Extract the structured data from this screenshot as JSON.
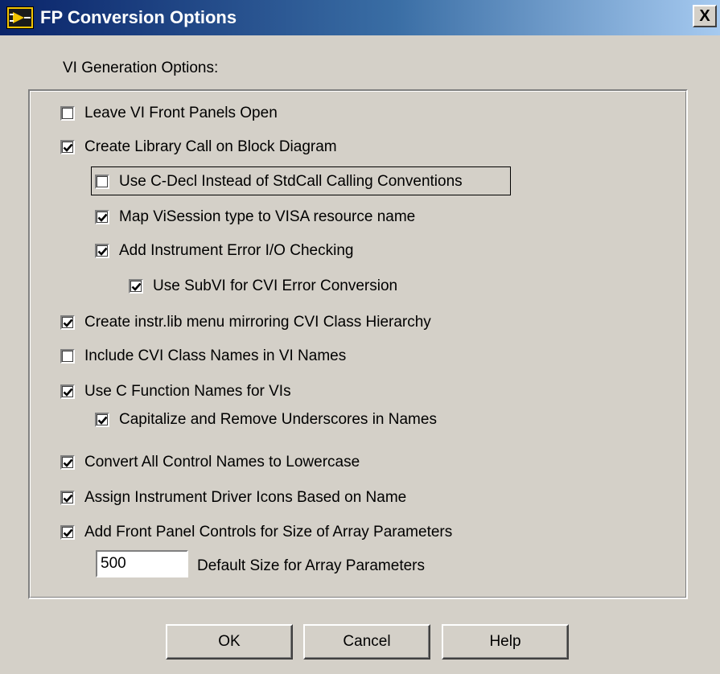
{
  "window": {
    "title": "FP Conversion Options",
    "close_label": "X"
  },
  "section_label": "VI Generation Options:",
  "options": [
    {
      "label": "Leave VI Front Panels Open",
      "checked": false
    },
    {
      "label": "Create Library Call on Block Diagram",
      "checked": true
    },
    {
      "label": "Use C-Decl Instead of StdCall Calling Conventions",
      "checked": false
    },
    {
      "label": "Map ViSession type to VISA resource name",
      "checked": true
    },
    {
      "label": "Add Instrument Error I/O Checking",
      "checked": true
    },
    {
      "label": "Use SubVI for CVI Error Conversion",
      "checked": true
    },
    {
      "label": "Create instr.lib menu mirroring CVI Class Hierarchy",
      "checked": true
    },
    {
      "label": "Include CVI Class Names in VI Names",
      "checked": false
    },
    {
      "label": "Use C Function Names for VIs",
      "checked": true
    },
    {
      "label": "Capitalize and Remove Underscores in Names",
      "checked": true
    },
    {
      "label": "Convert All Control Names to Lowercase",
      "checked": true
    },
    {
      "label": "Assign Instrument Driver Icons Based on Name",
      "checked": true
    },
    {
      "label": "Add Front Panel Controls for Size of Array Parameters",
      "checked": true
    }
  ],
  "array_size": {
    "value": "500",
    "label": "Default Size for Array Parameters"
  },
  "buttons": {
    "ok": "OK",
    "cancel": "Cancel",
    "help": "Help"
  }
}
